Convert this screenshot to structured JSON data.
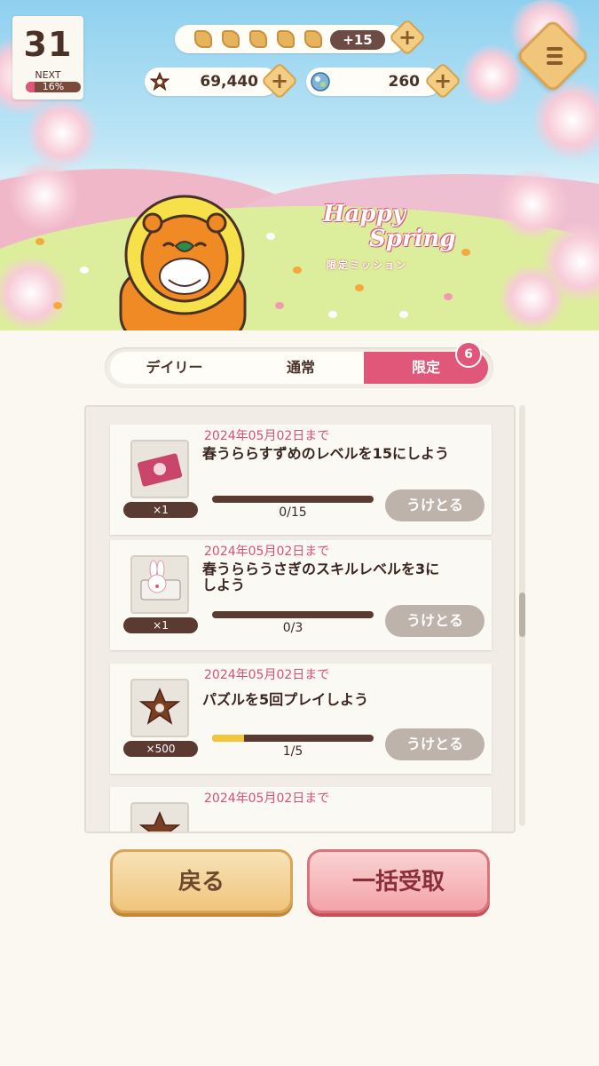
{
  "header": {
    "level": "31",
    "next_label": "NEXT",
    "next_percent_text": "16%",
    "next_progress": 0.16,
    "stamina_icons": 5,
    "stamina_bonus": "+15",
    "cookies": "69,440",
    "gems": "260",
    "plus_symbol": "+"
  },
  "banner": {
    "title_line1": "Happy",
    "title_line2": "Spring",
    "subtitle": "限定ミッション"
  },
  "tabs": {
    "daily": "デイリー",
    "normal": "通常",
    "limited": "限定",
    "limited_badge": "6",
    "active": "limited"
  },
  "missions": [
    {
      "deadline": "2024年05月02日まで",
      "title": "春うららすずめのレベルを15にしよう",
      "reward_qty": "×1",
      "reward_icon": "ticket-icon",
      "progress_text": "0/15",
      "progress": 0.0,
      "claim_label": "うけとる"
    },
    {
      "deadline": "2024年05月02日まで",
      "title": "春うららうさぎのスキルレベルを3にしよう",
      "reward_qty": "×1",
      "reward_icon": "rabbit-piano-icon",
      "progress_text": "0/3",
      "progress": 0.0,
      "claim_label": "うけとる"
    },
    {
      "deadline": "2024年05月02日まで",
      "title": "パズルを5回プレイしよう",
      "reward_qty": "×500",
      "reward_icon": "star-cookie-icon",
      "progress_text": "1/5",
      "progress": 0.2,
      "claim_label": "うけとる"
    },
    {
      "deadline": "2024年05月02日まで",
      "reward_icon": "star-cookie-icon"
    }
  ],
  "buttons": {
    "back": "戻る",
    "bulk_claim": "一括受取"
  },
  "colors": {
    "accent_pink": "#e0577a",
    "brown": "#5b3a32",
    "progress_yellow": "#f2c53a",
    "claim_disabled": "#bdb3ab"
  }
}
